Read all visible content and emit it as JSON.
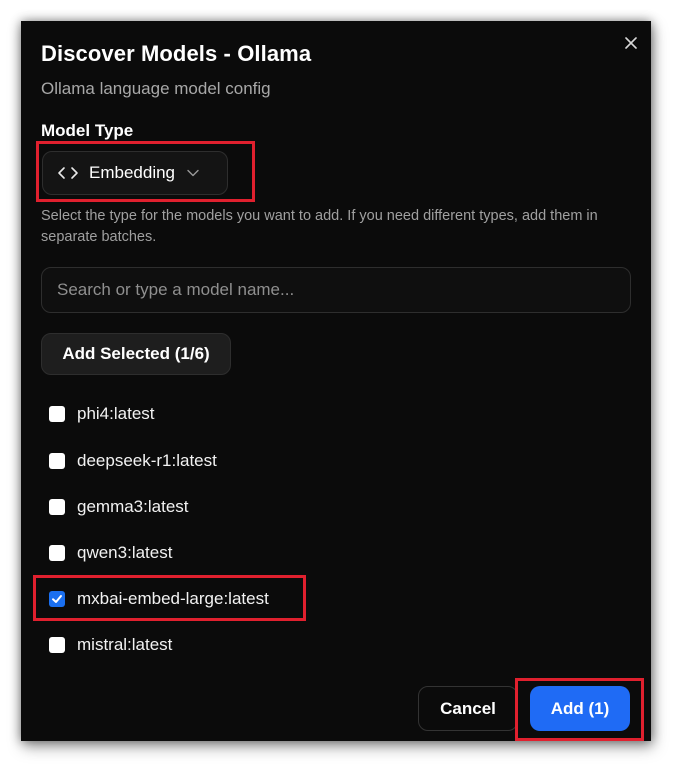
{
  "dialog": {
    "title": "Discover Models - Ollama",
    "subtitle": "Ollama language model config"
  },
  "model_type": {
    "label": "Model Type",
    "selected": "Embedding",
    "icon": "code-icon",
    "hint": "Select the type for the models you want to add. If you need different types, add them in separate batches."
  },
  "search": {
    "placeholder": "Search or type a model name...",
    "value": ""
  },
  "actions": {
    "add_selected_label": "Add Selected (1/6)",
    "cancel_label": "Cancel",
    "add_label": "Add (1)"
  },
  "models": [
    {
      "name": "phi4:latest",
      "checked": false
    },
    {
      "name": "deepseek-r1:latest",
      "checked": false
    },
    {
      "name": "gemma3:latest",
      "checked": false
    },
    {
      "name": "qwen3:latest",
      "checked": false
    },
    {
      "name": "mxbai-embed-large:latest",
      "checked": true
    },
    {
      "name": "mistral:latest",
      "checked": false
    }
  ],
  "colors": {
    "dialog_bg": "#0b0b0b",
    "accent": "#1f6bf5",
    "highlight": "#e0202e"
  }
}
